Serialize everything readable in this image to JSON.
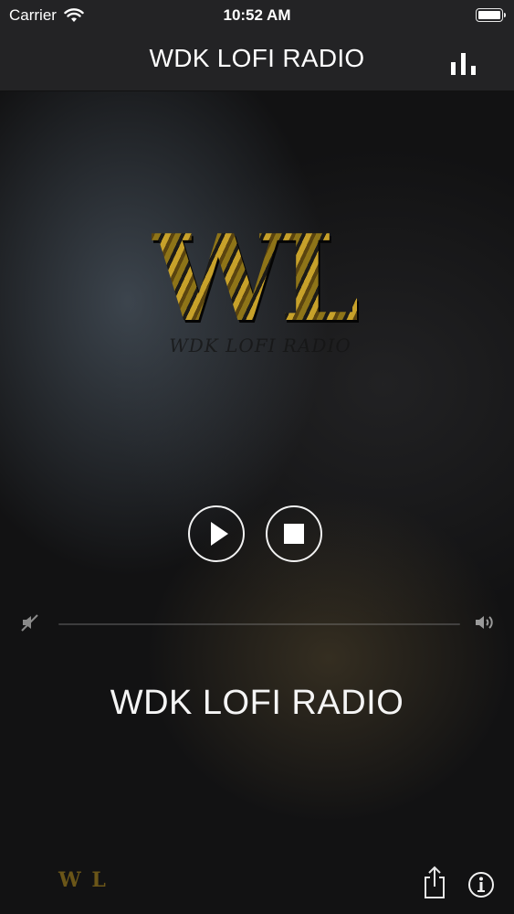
{
  "status_bar": {
    "carrier": "Carrier",
    "time": "10:52 AM",
    "icons": [
      "wifi-icon",
      "battery-icon"
    ]
  },
  "nav": {
    "title": "WDK LOFI RADIO",
    "right_icon": "equalizer-icon"
  },
  "logo": {
    "letters": "WL",
    "subtitle": "WDK LOFI RADIO"
  },
  "controls": {
    "play_icon": "play-icon",
    "stop_icon": "stop-icon"
  },
  "volume": {
    "min_icon": "volume-mute-icon",
    "max_icon": "volume-up-icon"
  },
  "station": {
    "name": "WDK LOFI RADIO"
  },
  "footer": {
    "mini_logo": "W L",
    "share_icon": "share-icon",
    "info_icon": "info-icon"
  },
  "colors": {
    "background": "#121213",
    "bar": "#232325",
    "accent_gold": "#c7a12a",
    "text": "#ffffff"
  }
}
